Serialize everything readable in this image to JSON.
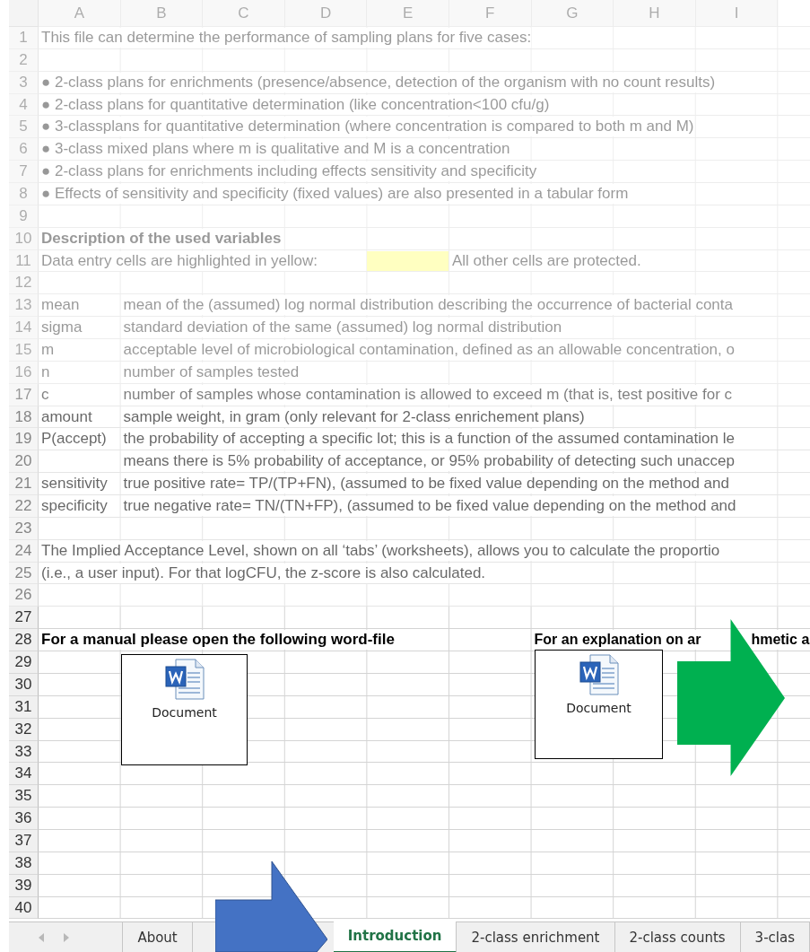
{
  "sheet": {
    "columns": [
      "A",
      "B",
      "C",
      "D",
      "E",
      "F",
      "G",
      "H",
      "I"
    ],
    "rows": [
      {
        "number": "1",
        "kind": "text",
        "text": "This file can determine the performance of sampling plans for five cases:"
      },
      {
        "number": "2",
        "kind": "blank"
      },
      {
        "number": "3",
        "kind": "text",
        "text": "● 2-class plans for enrichments (presence/absence, detection of the organism with no count results)"
      },
      {
        "number": "4",
        "kind": "text",
        "text": "● 2-class plans for quantitative determination (like concentration<100 cfu/g)"
      },
      {
        "number": "5",
        "kind": "text",
        "text": "● 3-classplans for quantitative determination (where concentration is compared to both m and M)"
      },
      {
        "number": "6",
        "kind": "text",
        "text": "● 3-class mixed plans where m is qualitative and M is a concentration"
      },
      {
        "number": "7",
        "kind": "text",
        "text": "● 2-class plans for enrichments including effects sensitivity and specificity"
      },
      {
        "number": "8",
        "kind": "text",
        "text": "● Effects of sensitivity and specificity (fixed values) are also presented in a tabular form"
      },
      {
        "number": "9",
        "kind": "blank"
      },
      {
        "number": "10",
        "kind": "heading",
        "text": "Description of the used variables"
      },
      {
        "number": "11",
        "kind": "legend",
        "text": "Data entry cells are highlighted in yellow:",
        "note": "All other cells are protected."
      },
      {
        "number": "12",
        "kind": "blank"
      },
      {
        "number": "13",
        "kind": "variable",
        "label": "mean",
        "text": "mean of the (assumed) log normal distribution describing the occurrence of bacterial conta"
      },
      {
        "number": "14",
        "kind": "variable",
        "label": "sigma",
        "text": "standard deviation of the same (assumed) log normal distribution"
      },
      {
        "number": "15",
        "kind": "variable",
        "label": "m",
        "text": "acceptable level of microbiological contamination, defined as an allowable concentration, o"
      },
      {
        "number": "16",
        "kind": "variable",
        "label": "n",
        "text": "number of samples tested"
      },
      {
        "number": "17",
        "kind": "variable",
        "label": "c",
        "text": "number of samples whose contamination is allowed to exceed m (that is, test positive for c"
      },
      {
        "number": "18",
        "kind": "variable",
        "label": "amount",
        "text": "sample weight, in gram (only relevant for 2-class enrichement plans)"
      },
      {
        "number": "19",
        "kind": "variable",
        "label": "P(accept)",
        "text": "the probability of accepting a specific lot; this is a function of the assumed contamination le"
      },
      {
        "number": "20",
        "kind": "variable",
        "text": "means there is 5% probability of acceptance, or 95% probability of detecting such unaccep"
      },
      {
        "number": "21",
        "kind": "variable",
        "label": "sensitivity",
        "text": "true positive rate= TP/(TP+FN), (assumed to be fixed value depending on the method and"
      },
      {
        "number": "22",
        "kind": "variable",
        "label": "specificity",
        "text": "true negative rate= TN/(TN+FP), (assumed to be fixed value depending on the method and"
      },
      {
        "number": "23",
        "kind": "blank"
      },
      {
        "number": "24",
        "kind": "text",
        "text": "The Implied Acceptance Level, shown on all ‘tabs’ (worksheets), allows you to calculate the proportio"
      },
      {
        "number": "25",
        "kind": "text",
        "text": "(i.e., a user input). For that logCFU, the z-score is also calculated."
      },
      {
        "number": "26",
        "kind": "blank"
      },
      {
        "number": "27",
        "kind": "blank"
      },
      {
        "number": "28",
        "kind": "links",
        "items": [
          "For a manual please open the following word-file",
          "For an explanation on ar",
          "hmetic a"
        ]
      },
      {
        "number": "29",
        "kind": "blank"
      },
      {
        "number": "30",
        "kind": "blank"
      },
      {
        "number": "31",
        "kind": "blank"
      },
      {
        "number": "32",
        "kind": "blank"
      },
      {
        "number": "33",
        "kind": "blank"
      },
      {
        "number": "34",
        "kind": "blank"
      },
      {
        "number": "35",
        "kind": "blank"
      },
      {
        "number": "36",
        "kind": "blank"
      },
      {
        "number": "37",
        "kind": "blank"
      },
      {
        "number": "38",
        "kind": "blank"
      },
      {
        "number": "39",
        "kind": "blank"
      },
      {
        "number": "40",
        "kind": "blank"
      }
    ],
    "objects": [
      {
        "label": "Document"
      },
      {
        "label": "Document"
      }
    ]
  },
  "tabs": [
    {
      "kind": "sheet",
      "label": "About",
      "selected": false
    },
    {
      "kind": "sheet",
      "label": "Introduction",
      "selected": true
    },
    {
      "kind": "sheet",
      "label": "2-class enrichment",
      "selected": false
    },
    {
      "kind": "sheet",
      "label": "2-class counts",
      "selected": false
    },
    {
      "kind": "sheet",
      "label": "3-clas",
      "selected": false
    }
  ]
}
